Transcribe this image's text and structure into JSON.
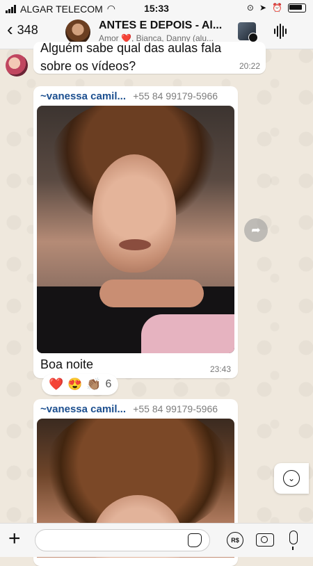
{
  "status_bar": {
    "carrier": "ALGAR TELECOM",
    "time": "15:33"
  },
  "header": {
    "back_count": "348",
    "title": "ANTES E DEPOIS - Al...",
    "subtitle": "Amor ❤️, Bianca, Danny (alu..."
  },
  "messages": {
    "top": {
      "text": "Alguém sabe qual das aulas fala sobre os vídeos?",
      "time": "20:22"
    },
    "media1": {
      "sender_name": "~vanessa camil...",
      "sender_phone": "+55 84 99179-5966",
      "caption": "Boa noite",
      "time": "23:43"
    },
    "reactions": {
      "emojis": [
        "❤️",
        "😍",
        "👏🏽"
      ],
      "count": "6"
    },
    "media2": {
      "sender_name": "~vanessa camil...",
      "sender_phone": "+55 84 99179-5966"
    }
  },
  "input": {
    "placeholder": "",
    "pix_label": "R$"
  },
  "icons": {
    "back": "chevron-left-icon",
    "voice": "audio-wave-icon",
    "forward": "forward-icon",
    "scroll": "chevron-down-icon",
    "plus": "plus-icon",
    "sticker": "sticker-icon",
    "camera": "camera-icon",
    "mic": "microphone-icon"
  }
}
